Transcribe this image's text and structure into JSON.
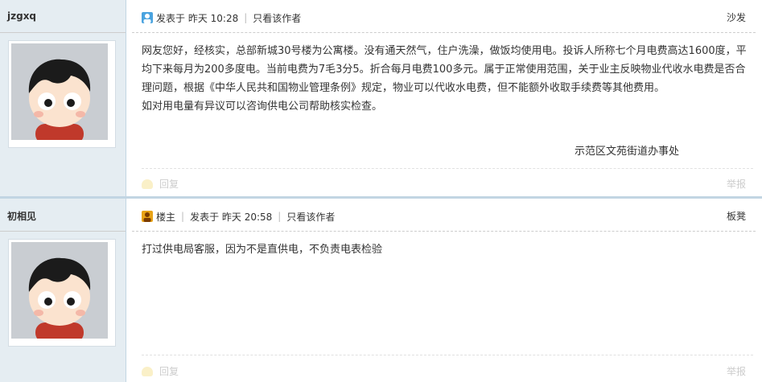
{
  "posts": [
    {
      "author": "jzgxq",
      "meta": {
        "posted": "发表于  昨天 10:28",
        "only_author": "只看该作者"
      },
      "floor": "沙发",
      "paragraphs": [
        "网友您好，经核实，总部新城30号楼为公寓楼。没有通天然气，住户洗澡，做饭均使用电。投诉人所称七个月电费高达1600度，平均下来每月为200多度电。当前电费为7毛3分5。折合每月电费100多元。属于正常使用范围，关于业主反映物业代收水电费是否合理问题，根据《中华人民共和国物业管理条例》规定，物业可以代收水电费，但不能额外收取手续费等其他费用。",
        "如对用电量有异议可以咨询供电公司帮助核实检查。"
      ],
      "signature": "示范区文苑街道办事处",
      "actions": {
        "reply": "回复",
        "report": "举报"
      }
    },
    {
      "author": "初相见",
      "meta": {
        "role": "楼主",
        "posted": "发表于  昨天 20:58",
        "only_author": "只看该作者"
      },
      "floor": "板凳",
      "paragraphs": [
        "打过供电局客服，因为不是直供电，不负责电表检验"
      ],
      "actions": {
        "reply": "回复",
        "report": "举报"
      }
    }
  ],
  "colors": {
    "sidebar_bg": "#e5edf2",
    "border": "#c2d5e3",
    "text": "#333333",
    "muted": "#cccccc"
  }
}
